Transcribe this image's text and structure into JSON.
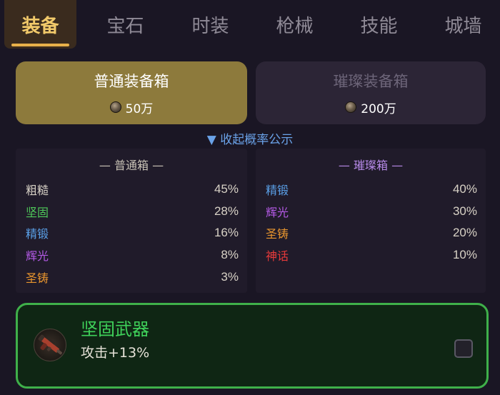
{
  "tabs": [
    {
      "label": "装备",
      "active": true
    },
    {
      "label": "宝石",
      "active": false
    },
    {
      "label": "时装",
      "active": false
    },
    {
      "label": "枪械",
      "active": false
    },
    {
      "label": "技能",
      "active": false
    },
    {
      "label": "城墙",
      "active": false
    }
  ],
  "chests": {
    "normal": {
      "title": "普通装备箱",
      "price": "50万"
    },
    "brilliant": {
      "title": "璀璨装备箱",
      "price": "200万"
    }
  },
  "collapse_label": "▼ 收起概率公示",
  "probability": {
    "normal": {
      "title": "— 普通箱 —",
      "rows": [
        {
          "name": "粗糙",
          "pct": "45%",
          "color": "#d8d2c6"
        },
        {
          "name": "坚固",
          "pct": "28%",
          "color": "#4fc95a"
        },
        {
          "name": "精锻",
          "pct": "16%",
          "color": "#5aa0e8"
        },
        {
          "name": "辉光",
          "pct": "8%",
          "color": "#b45ae6"
        },
        {
          "name": "圣铸",
          "pct": "3%",
          "color": "#e8952e"
        }
      ]
    },
    "brilliant": {
      "title": "— 璀璨箱 —",
      "rows": [
        {
          "name": "精锻",
          "pct": "40%",
          "color": "#5aa0e8"
        },
        {
          "name": "辉光",
          "pct": "30%",
          "color": "#b45ae6"
        },
        {
          "name": "圣铸",
          "pct": "20%",
          "color": "#e8952e"
        },
        {
          "name": "神话",
          "pct": "10%",
          "color": "#e83a3a"
        }
      ]
    }
  },
  "item": {
    "name": "坚固武器",
    "stat": "攻击+13%",
    "icon": "gun-icon",
    "selected": false
  }
}
